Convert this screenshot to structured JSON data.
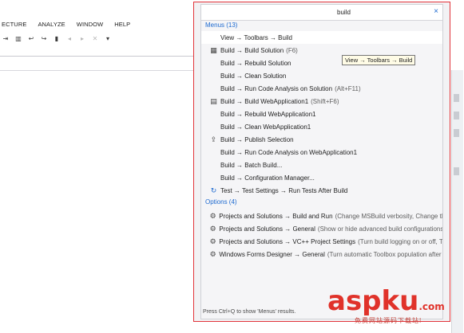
{
  "ide": {
    "menu": [
      "ECTURE",
      "ANALYZE",
      "WINDOW",
      "HELP"
    ],
    "toolbar_icons": [
      "indent-icon",
      "columns-icon",
      "undo-comment-icon",
      "uncomment-icon",
      "bookmark-icon",
      "prev-bookmark-icon",
      "next-bookmark-icon",
      "clear-bookmarks-icon",
      "dropdown-icon"
    ]
  },
  "quick_launch": {
    "search_value": "build",
    "close_label": "×",
    "menus_header": "Menus (13)",
    "options_header": "Options (4)",
    "tooltip": "View → Toolbars → Build",
    "status": "Press Ctrl+Q to show 'Menus' results.",
    "menus": [
      {
        "label": "View → Toolbars → Build",
        "hint": "",
        "icon": ""
      },
      {
        "label": "Build → Build Solution",
        "hint": "(F6)",
        "icon": "build-solution-icon"
      },
      {
        "label": "Build → Rebuild Solution",
        "hint": "",
        "icon": ""
      },
      {
        "label": "Build → Clean Solution",
        "hint": "",
        "icon": ""
      },
      {
        "label": "Build → Run Code Analysis on Solution",
        "hint": "(Alt+F11)",
        "icon": ""
      },
      {
        "label": "Build → Build WebApplication1",
        "hint": "(Shift+F6)",
        "icon": "build-project-icon"
      },
      {
        "label": "Build → Rebuild WebApplication1",
        "hint": "",
        "icon": ""
      },
      {
        "label": "Build → Clean WebApplication1",
        "hint": "",
        "icon": ""
      },
      {
        "label": "Build → Publish Selection",
        "hint": "",
        "icon": "publish-icon"
      },
      {
        "label": "Build → Run Code Analysis on WebApplication1",
        "hint": "",
        "icon": ""
      },
      {
        "label": "Build → Batch Build...",
        "hint": "",
        "icon": ""
      },
      {
        "label": "Build → Configuration Manager...",
        "hint": "",
        "icon": ""
      },
      {
        "label": "Test → Test Settings → Run Tests After Build",
        "hint": "",
        "icon": "test-settings-icon"
      }
    ],
    "options": [
      {
        "label": "Projects and Solutions → Build and Run",
        "hint": "(Change MSBuild verbosity, Change the nu..."
      },
      {
        "label": "Projects and Solutions → General",
        "hint": "(Show or hide advanced build configurations, Sho..."
      },
      {
        "label": "Projects and Solutions → VC++ Project Settings",
        "hint": "(Turn build logging on or off, Turn..."
      },
      {
        "label": "Windows Forms Designer → General",
        "hint": "(Turn automatic Toolbox population after rebui..."
      }
    ]
  },
  "watermark": {
    "logo": "aspku",
    "logo_suffix": ".com",
    "subtitle": "免费网站源码下载站!"
  }
}
